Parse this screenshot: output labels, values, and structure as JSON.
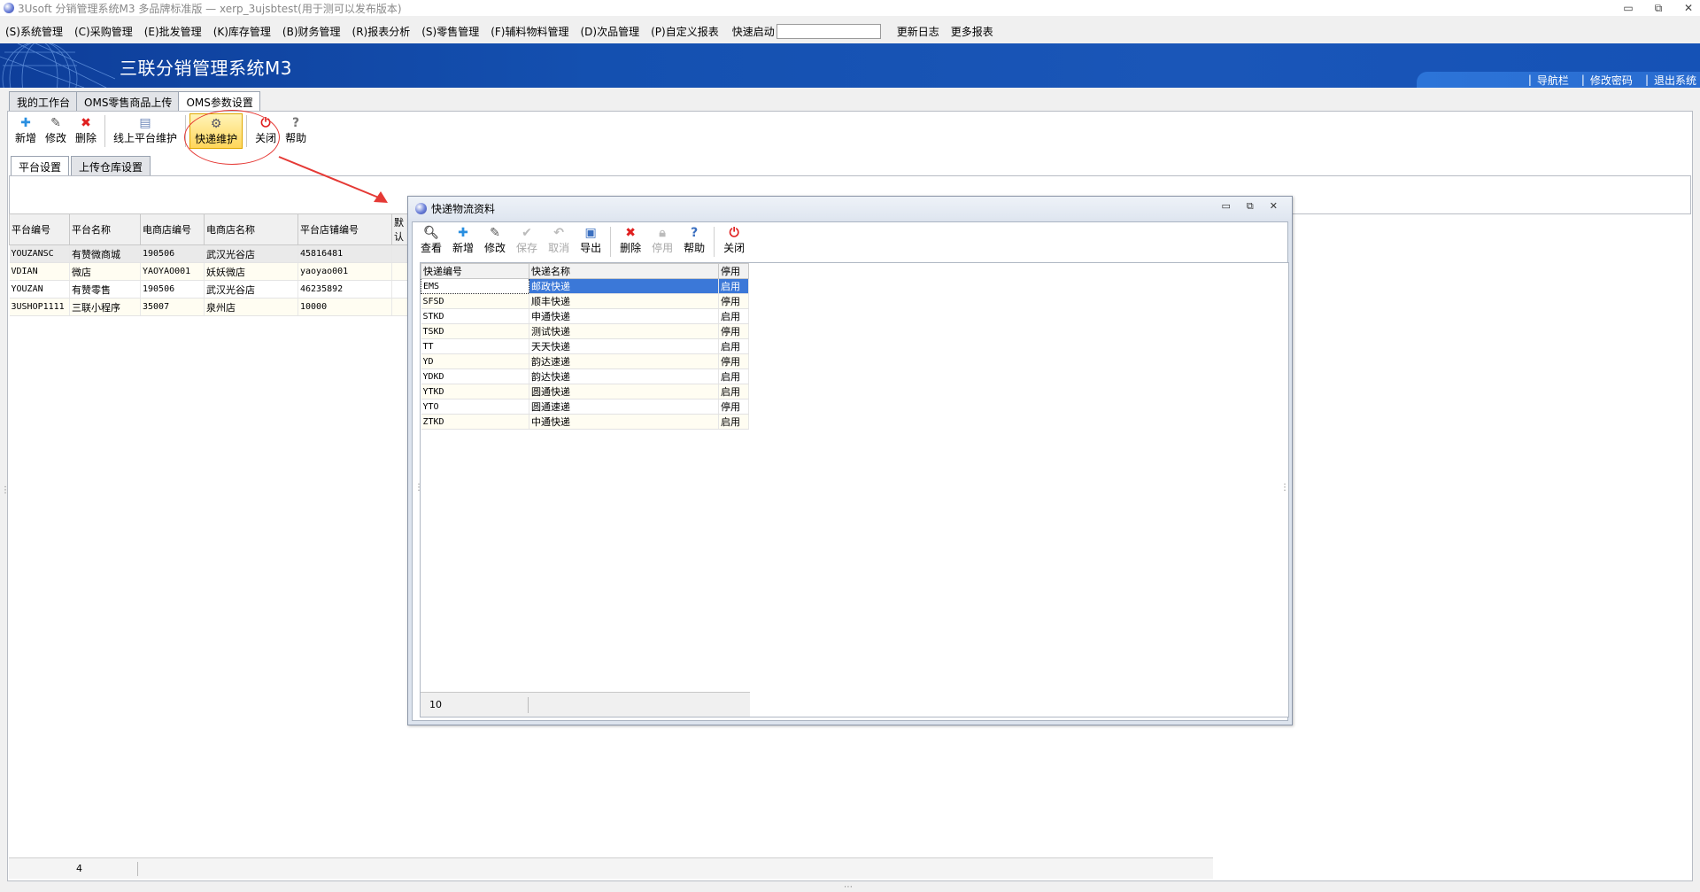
{
  "window": {
    "title": "3Usoft 分销管理系统M3 多品牌标准版 — xerp_3ujsbtest(用于测可以发布版本)",
    "controls": [
      "minimize",
      "restore",
      "close"
    ]
  },
  "menu": {
    "items": [
      "(S)系统管理",
      "(C)采购管理",
      "(E)批发管理",
      "(K)库存管理",
      "(B)财务管理",
      "(R)报表分析",
      "(S)零售管理",
      "(F)辅料物料管理",
      "(D)次品管理",
      "(P)自定义报表"
    ],
    "quick_label": "快速启动",
    "quick_value": "",
    "links": [
      "更新日志",
      "更多报表"
    ]
  },
  "banner": {
    "title": "三联分销管理系统M3",
    "nav": [
      "导航栏",
      "修改密码",
      "退出系统"
    ]
  },
  "doc_tabs": [
    "我的工作台",
    "OMS零售商品上传",
    "OMS参数设置"
  ],
  "toolbar": {
    "buttons": [
      "新增",
      "修改",
      "删除",
      "线上平台维护",
      "快递维护",
      "关闭",
      "帮助"
    ]
  },
  "sub_tabs": [
    "平台设置",
    "上传仓库设置"
  ],
  "platform_grid": {
    "columns": [
      "平台编号",
      "平台名称",
      "电商店编号",
      "电商店名称",
      "平台店铺编号",
      "默认"
    ],
    "rows": [
      [
        "YOUZANSC",
        "有赞微商城",
        "190506",
        "武汉光谷店",
        "45816481"
      ],
      [
        "VDIAN",
        "微店",
        "YAOYAO001",
        "妖妖微店",
        "yaoyao001"
      ],
      [
        "YOUZAN",
        "有赞零售",
        "190506",
        "武汉光谷店",
        "46235892"
      ],
      [
        "3USHOP1111",
        "三联小程序",
        "35007",
        "泉州店",
        "10000"
      ]
    ],
    "count": "4"
  },
  "dialog": {
    "title": "快递物流资料",
    "buttons": [
      "查看",
      "新增",
      "修改",
      "保存",
      "取消",
      "导出",
      "删除",
      "停用",
      "帮助",
      "关闭"
    ],
    "disabled": [
      "保存",
      "取消",
      "停用"
    ],
    "columns": [
      "快递编号",
      "快递名称",
      "停用"
    ],
    "rows": [
      [
        "EMS",
        "邮政快递",
        "启用"
      ],
      [
        "SFSD",
        "顺丰快递",
        "停用"
      ],
      [
        "STKD",
        "申通快递",
        "启用"
      ],
      [
        "TSKD",
        "测试快递",
        "停用"
      ],
      [
        "TT",
        "天天快递",
        "启用"
      ],
      [
        "YD",
        "韵达速递",
        "停用"
      ],
      [
        "YDKD",
        "韵达快递",
        "启用"
      ],
      [
        "YTKD",
        "圆通快递",
        "启用"
      ],
      [
        "YTO",
        "圆通速递",
        "停用"
      ],
      [
        "ZTKD",
        "中通快递",
        "启用"
      ]
    ],
    "count": "10"
  },
  "colors": {
    "banner": "#1450b0",
    "selection": "#3b78d8",
    "annotation": "#e53935",
    "highlight": "#ffd65a"
  }
}
